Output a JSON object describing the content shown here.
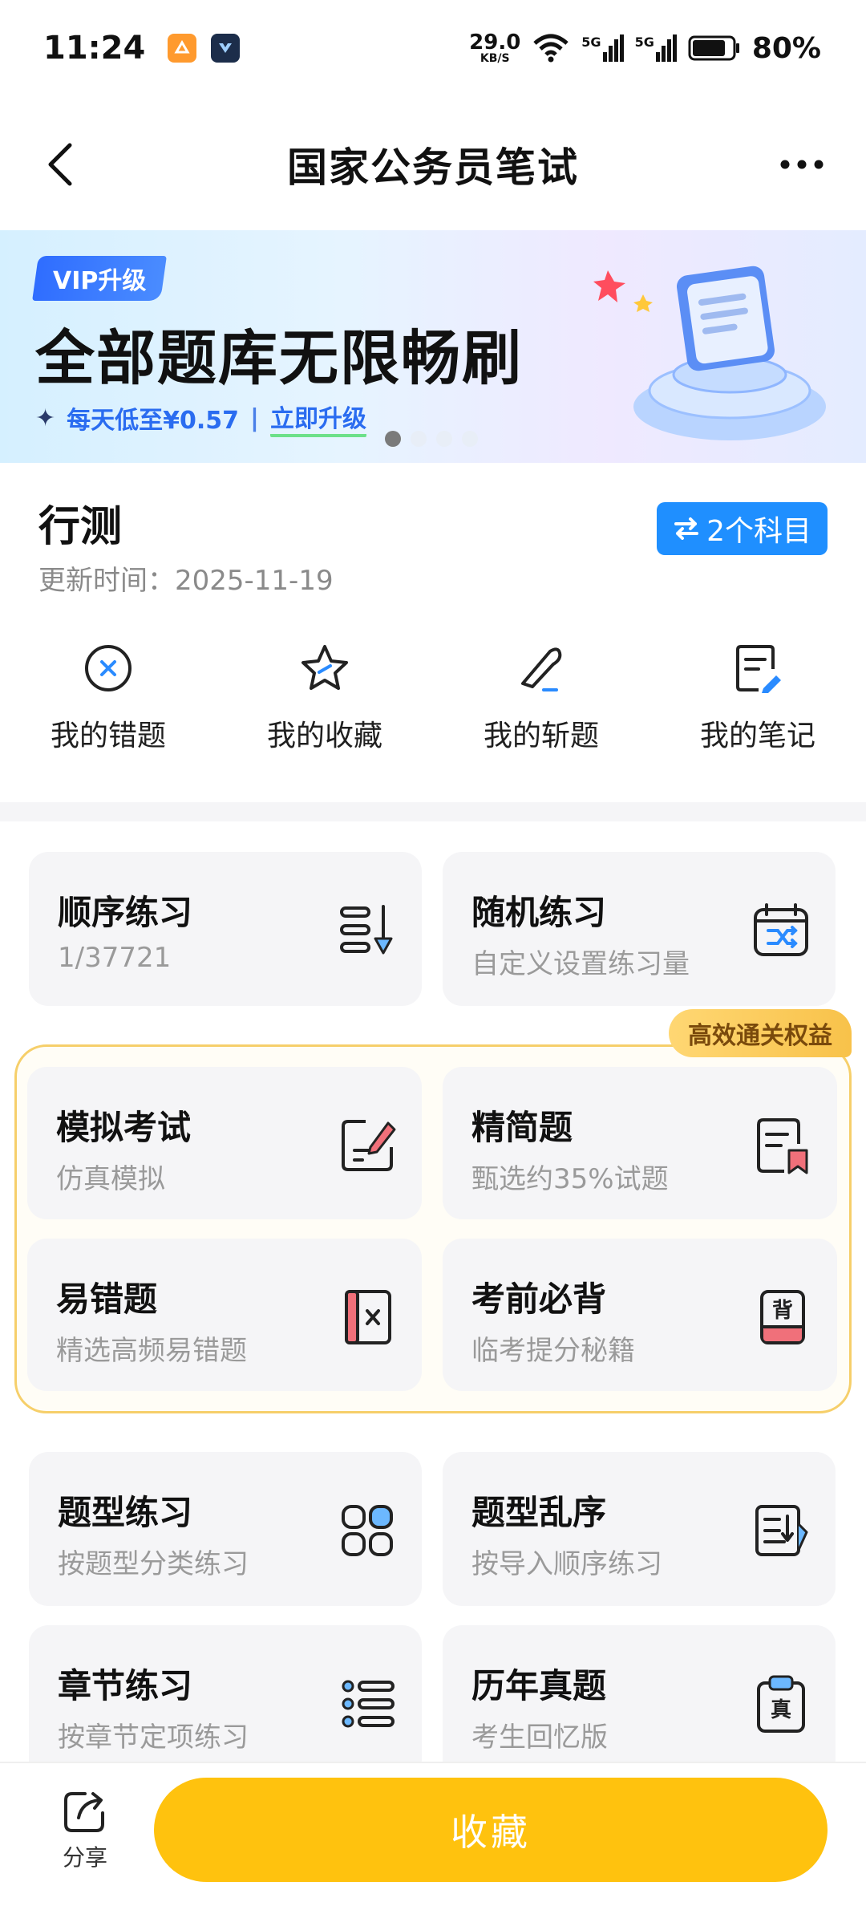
{
  "status_bar": {
    "time": "11:24",
    "net_speed_value": "29.0",
    "net_speed_unit": "KB/S",
    "battery": "80%",
    "signal_1": "5G",
    "signal_2": "5G"
  },
  "nav": {
    "title": "国家公务员笔试"
  },
  "banner": {
    "vip_tag": "VIP升级",
    "headline": "全部题库无限畅刷",
    "sub_price": "每天低至¥0.57",
    "sub_sep": "|",
    "sub_cta": "立即升级",
    "page_count": 4,
    "active_page": 1
  },
  "subject": {
    "title": "行测",
    "updated": "更新时间：2025-11-19",
    "switch_label": "2个科目"
  },
  "quick_actions": [
    {
      "label": "我的错题",
      "icon": "wrong-questions-icon"
    },
    {
      "label": "我的收藏",
      "icon": "star-icon"
    },
    {
      "label": "我的斩题",
      "icon": "knife-icon"
    },
    {
      "label": "我的笔记",
      "icon": "notes-icon"
    }
  ],
  "cards": {
    "sequential": {
      "title": "顺序练习",
      "sub": "1/37721",
      "icon": "sort-down-icon"
    },
    "random": {
      "title": "随机练习",
      "sub": "自定义设置练习量",
      "icon": "shuffle-calendar-icon"
    },
    "mock_exam": {
      "title": "模拟考试",
      "sub": "仿真模拟",
      "icon": "edit-paper-icon"
    },
    "refined": {
      "title": "精简题",
      "sub": "甄选约35%试题",
      "icon": "bookmark-doc-icon"
    },
    "error_prone": {
      "title": "易错题",
      "sub": "精选高频易错题",
      "icon": "error-book-icon"
    },
    "must_memorize": {
      "title": "考前必背",
      "sub": "临考提分秘籍",
      "icon": "memorize-book-icon",
      "icon_text": "背"
    },
    "type_practice": {
      "title": "题型练习",
      "sub": "按题型分类练习",
      "icon": "grid-icon"
    },
    "type_shuffle": {
      "title": "题型乱序",
      "sub": "按导入顺序练习",
      "icon": "list-doc-icon"
    },
    "chapter_practice": {
      "title": "章节练习",
      "sub": "按章节定项练习",
      "icon": "list-icon"
    },
    "past_papers": {
      "title": "历年真题",
      "sub": "考生回忆版",
      "icon": "clipboard-icon",
      "icon_text": "真"
    }
  },
  "premium": {
    "badge": "高效通关权益"
  },
  "bottom": {
    "share_label": "分享",
    "collect_label": "收藏"
  },
  "colors": {
    "primary_blue": "#1f8fff",
    "accent_yellow": "#ffc20e",
    "premium_border": "#f6cf6a",
    "card_bg": "#f5f5f7",
    "icon_blue": "#2a8bff",
    "icon_red": "#f0707a"
  }
}
